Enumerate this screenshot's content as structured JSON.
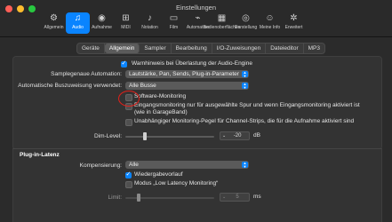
{
  "window": {
    "title": "Einstellungen"
  },
  "toolbar": [
    {
      "label": "Allgemein",
      "icon": "gear-icon",
      "glyph": "⚙",
      "active": false
    },
    {
      "label": "Audio",
      "icon": "audio-waveform-icon",
      "glyph": "♫",
      "active": true
    },
    {
      "label": "Aufnahme",
      "icon": "record-icon",
      "glyph": "◉",
      "active": false
    },
    {
      "label": "MIDI",
      "icon": "midi-icon",
      "glyph": "⊞",
      "active": false
    },
    {
      "label": "Notation",
      "icon": "notation-icon",
      "glyph": "♪",
      "active": false
    },
    {
      "label": "Film",
      "icon": "film-icon",
      "glyph": "▭",
      "active": false
    },
    {
      "label": "Automation",
      "icon": "automation-icon",
      "glyph": "⌁",
      "active": false
    },
    {
      "label": "Bedienoberflächen",
      "icon": "control-surface-icon",
      "glyph": "▦",
      "active": false
    },
    {
      "label": "Darstellung",
      "icon": "eye-icon",
      "glyph": "◎",
      "active": false
    },
    {
      "label": "Meine Info",
      "icon": "person-icon",
      "glyph": "☺",
      "active": false
    },
    {
      "label": "Erweitert",
      "icon": "advanced-gear-icon",
      "glyph": "✲",
      "active": false
    }
  ],
  "tabs": [
    {
      "label": "Geräte",
      "selected": false
    },
    {
      "label": "Allgemein",
      "selected": true
    },
    {
      "label": "Sampler",
      "selected": false
    },
    {
      "label": "Bearbeitung",
      "selected": false
    },
    {
      "label": "I/O-Zuweisungen",
      "selected": false
    },
    {
      "label": "Dateieditor",
      "selected": false
    },
    {
      "label": "MP3",
      "selected": false
    }
  ],
  "general": {
    "overload_warning": {
      "label": "Warnhinweis bei Überlastung der Audio-Engine",
      "checked": true
    },
    "sample_automation": {
      "label": "Samplegenaue Automation:",
      "value": "Lautstärke, Pan, Sends, Plug-in-Parameter"
    },
    "bus_routing": {
      "label": "Automatische Buszuweisung verwendet:",
      "value": "Alle Busse"
    },
    "software_monitoring": {
      "label": "Software-Monitoring",
      "checked": false
    },
    "input_monitoring": {
      "label": "Eingangsmonitoring nur für ausgewählte Spur und wenn Eingangsmonitoring aktiviert ist",
      "label2": "(wie in GarageBand)",
      "checked": false
    },
    "independent_level": {
      "label": "Unabhängiger Monitoring-Pegel für Channel-Strips, die für die Aufnahme aktiviert sind",
      "checked": false
    },
    "dim_level": {
      "label": "Dim-Level:",
      "value": "-20",
      "unit": "dB",
      "fraction": 0.22
    }
  },
  "plugin_latency": {
    "heading": "Plug-in-Latenz",
    "compensation": {
      "label": "Kompensierung:",
      "value": "Alle"
    },
    "playback_preroll": {
      "label": "Wiedergabevorlauf",
      "checked": true
    },
    "low_latency": {
      "label": "Modus „Low Latency Monitoring“",
      "checked": false
    },
    "limit": {
      "label": "Limit:",
      "value": "5",
      "unit": "ms",
      "fraction": 0.15
    }
  },
  "colors": {
    "accent": "#0a84ff",
    "highlight": "#e0201a"
  }
}
